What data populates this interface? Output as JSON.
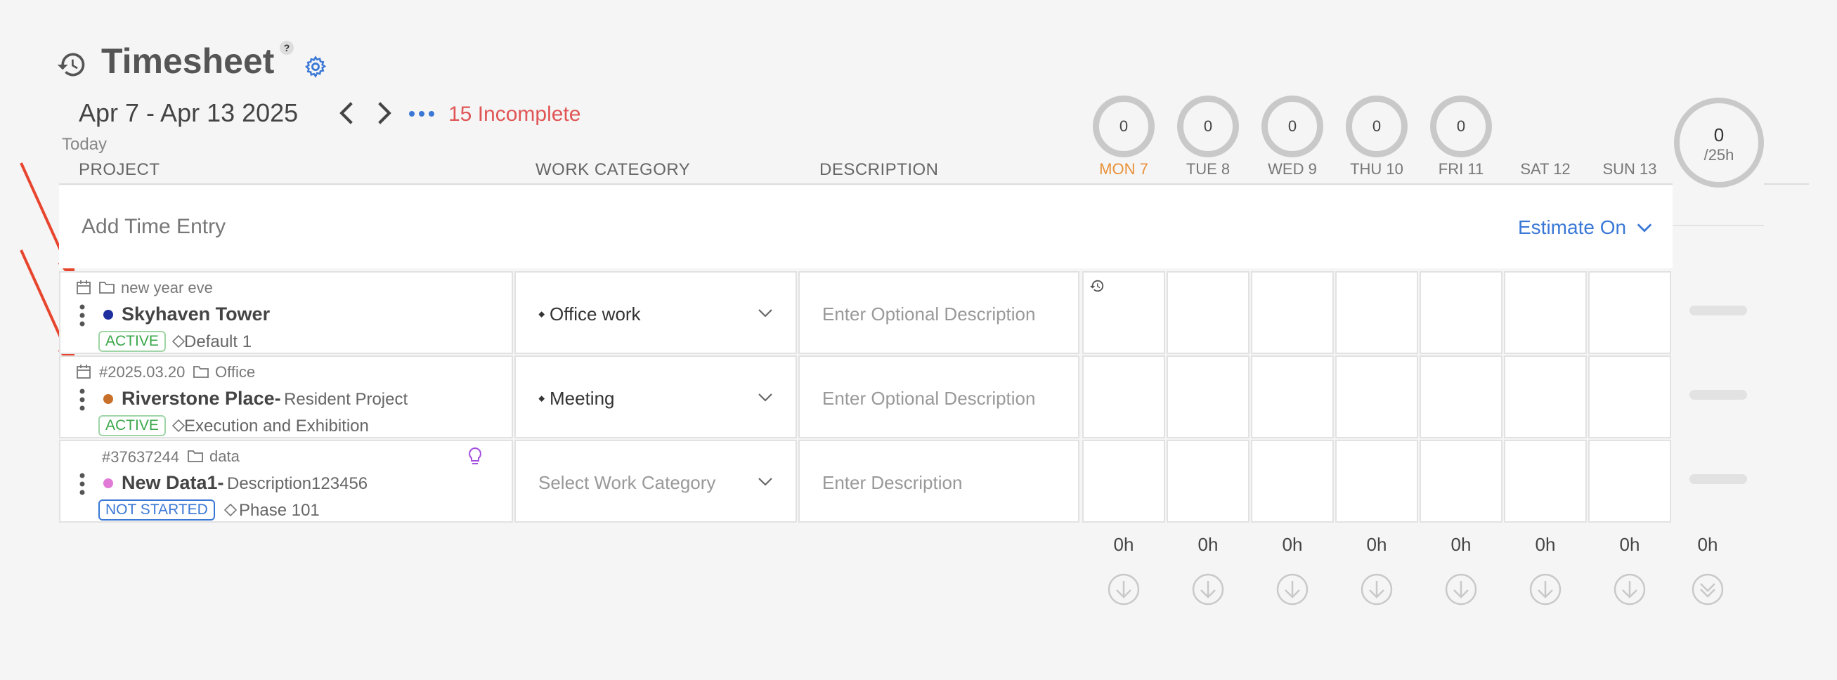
{
  "header": {
    "title": "Timesheet",
    "help": "?",
    "date_range": "Apr 7 - Apr 13 2025",
    "incomplete": "15 Incomplete",
    "today": "Today"
  },
  "columns": {
    "project": "PROJECT",
    "work_category": "WORK CATEGORY",
    "description": "DESCRIPTION"
  },
  "days": [
    {
      "label": "MON 7",
      "circle": "0",
      "total": "0h",
      "is_today": true
    },
    {
      "label": "TUE 8",
      "circle": "0",
      "total": "0h"
    },
    {
      "label": "WED 9",
      "circle": "0",
      "total": "0h"
    },
    {
      "label": "THU 10",
      "circle": "0",
      "total": "0h"
    },
    {
      "label": "FRI 11",
      "circle": "0",
      "total": "0h"
    },
    {
      "label": "SAT 12",
      "circle": "",
      "total": "0h"
    },
    {
      "label": "SUN 13",
      "circle": "",
      "total": "0h"
    }
  ],
  "week_total": {
    "value": "0",
    "target": "/25h",
    "total": "0h"
  },
  "add_entry": {
    "label": "Add Time Entry",
    "estimate": "Estimate On"
  },
  "rows": [
    {
      "meta_id": "",
      "meta_folder": "new year eve",
      "name": "Skyhaven Tower",
      "sub": "",
      "dot_color": "#1f2f9e",
      "status": "ACTIVE",
      "phase": "Default 1",
      "category": "Office work",
      "category_placeholder": false,
      "description_placeholder": "Enter Optional Description"
    },
    {
      "meta_id": "#2025.03.20",
      "meta_folder": "Office",
      "name": "Riverstone Place-",
      "sub": "Resident Project",
      "dot_color": "#c8702a",
      "status": "ACTIVE",
      "phase": "Execution and Exhibition",
      "category": "Meeting",
      "category_placeholder": false,
      "description_placeholder": "Enter Optional Description"
    },
    {
      "meta_id": "#37637244",
      "meta_folder": "data",
      "name": "New Data1-",
      "sub": "Description123456",
      "dot_color": "#e07ad6",
      "status": "NOT STARTED",
      "phase": "Phase 101",
      "category": "Select Work Category",
      "category_placeholder": true,
      "description_placeholder": "Enter Description"
    }
  ],
  "colors": {
    "accent": "#3b78d6",
    "alert": "#e05656",
    "today": "#e8913a",
    "active": "#3aa74a",
    "arrow": "#e8452e"
  },
  "icons": [
    "history-icon",
    "help-icon",
    "gear-icon",
    "chevron-left-icon",
    "chevron-right-icon",
    "more-dots-icon",
    "calendar-icon",
    "folder-icon",
    "tag-icon",
    "kebab-icon",
    "lightbulb-icon",
    "chevron-down-icon",
    "download-icon"
  ]
}
